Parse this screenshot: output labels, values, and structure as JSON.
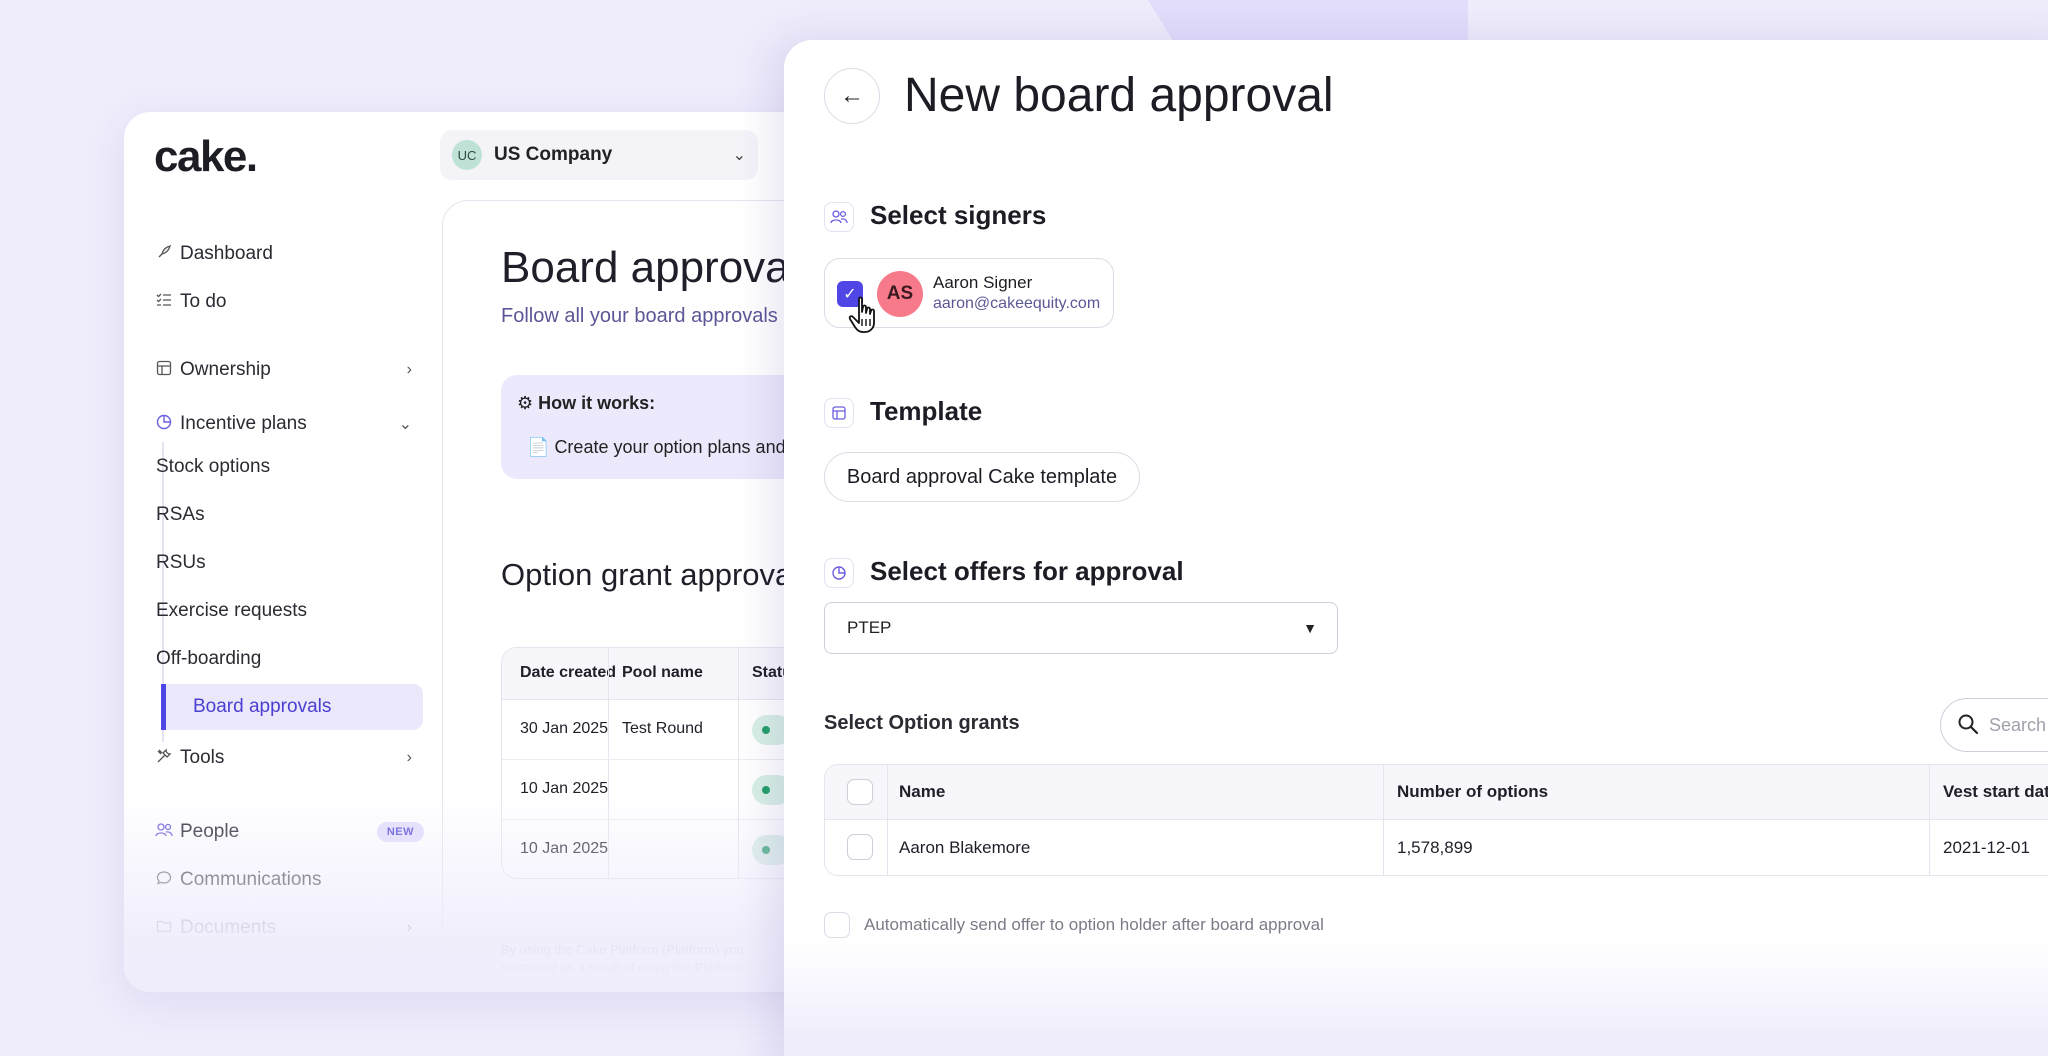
{
  "colors": {
    "accent": "#4f46e5",
    "background": "#efecfc",
    "success": "#27a069",
    "avatar_pink": "#f77a8b"
  },
  "app": {
    "logo": "cake."
  },
  "company": {
    "initials": "UC",
    "name": "US Company"
  },
  "sidebar": {
    "items": [
      {
        "label": "Dashboard",
        "icon": "rocket-icon"
      },
      {
        "label": "To do",
        "icon": "checklist-icon"
      },
      {
        "label": "Ownership",
        "icon": "table-icon"
      },
      {
        "label": "Incentive plans",
        "icon": "pie-icon"
      },
      {
        "label": "Tools",
        "icon": "tools-icon"
      },
      {
        "label": "People",
        "icon": "people-icon",
        "badge": "NEW"
      },
      {
        "label": "Communications",
        "icon": "chat-icon"
      },
      {
        "label": "Documents",
        "icon": "folder-icon"
      }
    ],
    "sub_items": [
      "Stock options",
      "RSAs",
      "RSUs",
      "Exercise requests",
      "Off-boarding",
      "Board approvals"
    ]
  },
  "board_approvals": {
    "title": "Board approvals",
    "subtitle": "Follow all your board approvals",
    "how_title": "How it works:",
    "how_text": "Create your option plans and",
    "option_title": "Option grant approvals",
    "columns": [
      "Date created",
      "Pool name",
      "Status"
    ],
    "rows": [
      {
        "date": "30 Jan 2025",
        "pool": "Test Round"
      },
      {
        "date": "10 Jan 2025",
        "pool": ""
      },
      {
        "date": "10 Jan 2025",
        "pool": ""
      }
    ],
    "legal_line1": "By using the Cake Platform (Platform) you",
    "legal_line2": "sustained as a result of using the Platform"
  },
  "panel": {
    "title": "New board approval",
    "signers_title": "Select signers",
    "signer": {
      "initials": "AS",
      "name": "Aaron Signer",
      "email": "aaron@cakeequity.com"
    },
    "template_title": "Template",
    "template_chip": "Board approval Cake template",
    "offers_title": "Select offers for approval",
    "offers_value": "PTEP",
    "grants_title": "Select Option grants",
    "search_placeholder": "Search",
    "grant_columns": [
      "Name",
      "Number of options",
      "Vest start date"
    ],
    "grant_rows": [
      {
        "name": "Aaron Blakemore",
        "options": "1,578,899",
        "vest": "2021-12-01"
      }
    ],
    "auto_send": "Automatically send offer to option holder after board approval"
  }
}
